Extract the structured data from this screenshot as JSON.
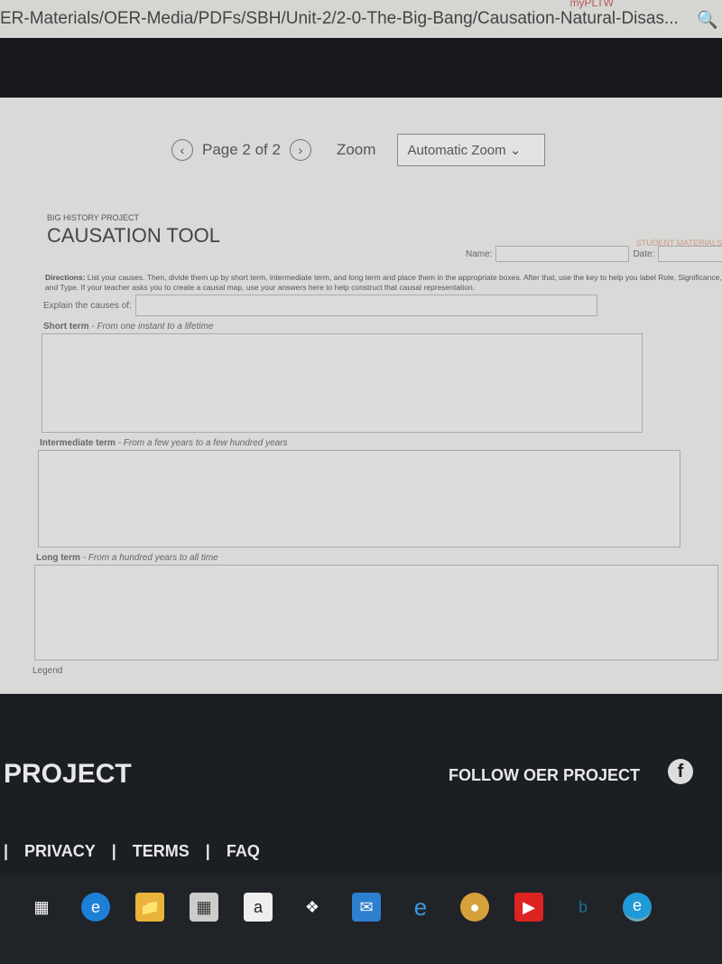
{
  "browser": {
    "url": "ER-Materials/OER-Media/PDFs/SBH/Unit-2/2-0-The-Big-Bang/Causation-Natural-Disas...",
    "tab_hint": "myPLTW"
  },
  "viewer": {
    "page_label": "Page 2 of 2",
    "zoom_label": "Zoom",
    "zoom_value": "Automatic Zoom"
  },
  "doc": {
    "project": "BIG HISTORY PROJECT",
    "title": "CAUSATION TOOL",
    "badge": "STUDENT MATERIALS",
    "name_label": "Name:",
    "date_label": "Date:",
    "directions_bold": "Directions:",
    "directions": " List your causes. Then, divide them up by short term, intermediate term, and long term and place them in the appropriate boxes. After that, use the key to help you label Role, Significance, and Type. If your teacher asks you to create a causal map, use your answers here to help construct that causal representation.",
    "explain_label": "Explain the causes of:",
    "sections": [
      {
        "label": "Short term",
        "desc": " - From one instant to a lifetime"
      },
      {
        "label": "Intermediate term",
        "desc": " - From a few years to a few hundred years"
      },
      {
        "label": "Long term",
        "desc": " - From a hundred years to all time"
      }
    ],
    "legend": "Legend"
  },
  "footer": {
    "brand": "PROJECT",
    "follow": "FOLLOW OER PROJECT",
    "links": [
      "PRIVACY",
      "TERMS",
      "FAQ"
    ]
  },
  "taskbar": [
    "task-view",
    "edge",
    "file-explorer",
    "store",
    "amazon",
    "dropbox",
    "mail",
    "internet-explorer",
    "chrome",
    "youtube",
    "bing",
    "edge-active"
  ]
}
